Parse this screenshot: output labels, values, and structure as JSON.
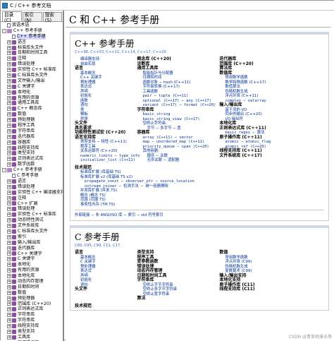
{
  "window": {
    "title": "C / C++ 参考文档"
  },
  "tabs": [
    {
      "label": "目录(C)"
    },
    {
      "label": "索引(N)"
    },
    {
      "label": "搜索(S)"
    }
  ],
  "tree": [
    {
      "t": "双语术语",
      "ic": "pg",
      "d": 0
    },
    {
      "t": "C++ 参考手册",
      "ic": "op",
      "d": 0,
      "ex": "-"
    },
    {
      "t": "C++ 参考手册",
      "ic": "pg",
      "d": 1,
      "sel": true
    },
    {
      "t": "语言",
      "ic": "bk",
      "d": 1,
      "ex": "+"
    },
    {
      "t": "标准库头文件",
      "ic": "bk",
      "d": 1,
      "ex": "+"
    },
    {
      "t": "日期和时间工具",
      "ic": "bk",
      "d": 1,
      "ex": "+"
    },
    {
      "t": "注释",
      "ic": "bk",
      "d": 1,
      "ex": "+"
    },
    {
      "t": "错误处理",
      "ic": "bk",
      "d": 1,
      "ex": "+"
    },
    {
      "t": "实验性 C++ 标准库",
      "ic": "bk",
      "d": 1,
      "ex": "+"
    },
    {
      "t": "C 标准库头文件",
      "ic": "bk",
      "d": 1,
      "ex": "+"
    },
    {
      "t": "文件输入/输出",
      "ic": "bk",
      "d": 1,
      "ex": "+"
    },
    {
      "t": "C 关键字",
      "ic": "bk",
      "d": 1,
      "ex": "+"
    },
    {
      "t": "本地化",
      "ic": "bk",
      "d": 1,
      "ex": "+"
    },
    {
      "t": "有用的资源",
      "ic": "bk",
      "d": 1,
      "ex": "+"
    },
    {
      "t": "通用工具库",
      "ic": "bk",
      "d": 1,
      "ex": "+"
    },
    {
      "t": "C++ 概念库",
      "ic": "bk",
      "d": 1,
      "ex": "+"
    },
    {
      "t": "数值",
      "ic": "bk",
      "d": 1,
      "ex": "+"
    },
    {
      "t": "预处理器",
      "ic": "bk",
      "d": 1,
      "ex": "+"
    },
    {
      "t": "程序工具",
      "ic": "bk",
      "d": 1,
      "ex": "+"
    },
    {
      "t": "字符串库",
      "ic": "bk",
      "d": 1,
      "ex": "+"
    },
    {
      "t": "迭代器库",
      "ic": "bk",
      "d": 1,
      "ex": "+"
    },
    {
      "t": "容器库",
      "ic": "bk",
      "d": 1,
      "ex": "+"
    },
    {
      "t": "线程支持库",
      "ic": "bk",
      "d": 1,
      "ex": "+"
    },
    {
      "t": "类型支持",
      "ic": "bk",
      "d": 1,
      "ex": "+"
    },
    {
      "t": "正则表达式库",
      "ic": "bk",
      "d": 1,
      "ex": "+"
    },
    {
      "t": "数学函数",
      "ic": "bk",
      "d": 1,
      "ex": "+"
    },
    {
      "t": "C++ 参考手册",
      "ic": "op",
      "d": 0,
      "ex": "-"
    },
    {
      "t": "C 参考手册",
      "ic": "pg",
      "d": 1
    },
    {
      "t": "语言",
      "ic": "bk",
      "d": 1,
      "ex": "+"
    },
    {
      "t": "错误处理",
      "ic": "bk",
      "d": 1,
      "ex": "+"
    },
    {
      "t": "实验性 C++ 编译器支持",
      "ic": "bk",
      "d": 1,
      "ex": "+"
    },
    {
      "t": "注释",
      "ic": "bk",
      "d": 1,
      "ex": "+"
    },
    {
      "t": "C++ 扩展",
      "ic": "bk",
      "d": 1,
      "ex": "+"
    },
    {
      "t": "错误处理",
      "ic": "bk",
      "d": 1,
      "ex": "+"
    },
    {
      "t": "实验性 C++ 标准库",
      "ic": "bk",
      "d": 1,
      "ex": "+"
    },
    {
      "t": "动态特性测试",
      "ic": "bk",
      "d": 1,
      "ex": "+"
    },
    {
      "t": "文件系统库",
      "ic": "bk",
      "d": 1,
      "ex": "+"
    },
    {
      "t": "C 标准库头文件",
      "ic": "bk",
      "d": 1,
      "ex": "+"
    },
    {
      "t": "索引",
      "ic": "bk",
      "d": 1,
      "ex": "+"
    },
    {
      "t": "输入/输出库",
      "ic": "bk",
      "d": 1,
      "ex": "+"
    },
    {
      "t": "迭代器库",
      "ic": "bk",
      "d": 1,
      "ex": "+"
    },
    {
      "t": "C++ 关键字",
      "ic": "bk",
      "d": 1,
      "ex": "+"
    },
    {
      "t": "C 关键字",
      "ic": "bk",
      "d": 1,
      "ex": "+"
    },
    {
      "t": "本地化",
      "ic": "bk",
      "d": 1,
      "ex": "+"
    },
    {
      "t": "有用的资源",
      "ic": "bk",
      "d": 1,
      "ex": "+"
    },
    {
      "t": "本地化库",
      "ic": "bk",
      "d": 1,
      "ex": "+"
    },
    {
      "t": "动态内存管理",
      "ic": "bk",
      "d": 1,
      "ex": "+"
    },
    {
      "t": "日期和时间",
      "ic": "bk",
      "d": 1,
      "ex": "+"
    },
    {
      "t": "数值",
      "ic": "bk",
      "d": 1,
      "ex": "+"
    },
    {
      "t": "预处理器",
      "ic": "bk",
      "d": 1,
      "ex": "+"
    },
    {
      "t": "范围库 (C++20)",
      "ic": "bk",
      "d": 1,
      "ex": "+"
    },
    {
      "t": "正则表达式库",
      "ic": "bk",
      "d": 1,
      "ex": "+"
    },
    {
      "t": "字符串库",
      "ic": "bk",
      "d": 1,
      "ex": "+"
    },
    {
      "t": "字符串库",
      "ic": "bk",
      "d": 1,
      "ex": "+"
    },
    {
      "t": "线程支持库",
      "ic": "bk",
      "d": 1,
      "ex": "+"
    },
    {
      "t": "类型支持",
      "ic": "bk",
      "d": 1,
      "ex": "+"
    },
    {
      "t": "工具库",
      "ic": "bk",
      "d": 1,
      "ex": "+"
    },
    {
      "t": "原子操作库",
      "ic": "bk",
      "d": 1,
      "ex": "+"
    }
  ],
  "main": {
    "title": "C 和 C++ 参考手册",
    "cpp": {
      "title": "C++ 参考手册",
      "versions": "C++98, C++03, C++11, C++14, C++17, C++20",
      "col1": [
        {
          "t": "编译器支持",
          "c": "i1"
        },
        {
          "t": "自由实现",
          "c": "i1"
        },
        {
          "t": "语言",
          "c": "b"
        },
        {
          "t": "基本概念",
          "c": "i1"
        },
        {
          "t": "C++ 关键字",
          "c": "i1"
        },
        {
          "t": "预处理器",
          "c": "i1"
        },
        {
          "t": "表达式",
          "c": "i1"
        },
        {
          "t": "声明",
          "c": "i1"
        },
        {
          "t": "初始化",
          "c": "i1"
        },
        {
          "t": "函数",
          "c": "i1"
        },
        {
          "t": "语句",
          "c": "i1"
        },
        {
          "t": "类",
          "c": "i1"
        },
        {
          "t": "模板",
          "c": "i1"
        },
        {
          "t": "异常",
          "c": "i1"
        },
        {
          "t": "头文件",
          "c": "b"
        },
        {
          "t": "具名要求",
          "c": "b"
        },
        {
          "t": "功能特性测试宏 (C++20)",
          "c": "b"
        },
        {
          "t": "语言支持库",
          "c": "b"
        },
        {
          "t": "类型支持 − 特性 (C++11)",
          "c": "i1"
        },
        {
          "t": "程序工具",
          "c": "i1"
        },
        {
          "t": "关系运算符 (C++20)",
          "c": "i1"
        },
        {
          "t": "numeric_limits − type_info",
          "c": "i1 m"
        },
        {
          "t": "initializer_list (C++11)",
          "c": "i1 m"
        }
      ],
      "col2": [
        {
          "t": "概念库 (C++20)",
          "c": "b"
        },
        {
          "t": "诊断库",
          "c": "b"
        },
        {
          "t": "通用工具库",
          "c": "b"
        },
        {
          "t": "智能指针与分配器",
          "c": "i1"
        },
        {
          "t": "日期和时间",
          "c": "i1"
        },
        {
          "t": "函数对象 − hash (C++11)",
          "c": "i1"
        },
        {
          "t": "字符串转换 (C++17)",
          "c": "i1"
        },
        {
          "t": "工具函数",
          "c": "i1"
        },
        {
          "t": "pair − tuple (C++11)",
          "c": "i1 m"
        },
        {
          "t": "optional (C++17) − any (C++17)",
          "c": "i1 m"
        },
        {
          "t": "variant (C++17) − format (C++20)",
          "c": "i1 m"
        },
        {
          "t": "字符串库",
          "c": "b"
        },
        {
          "t": "basic_string",
          "c": "i1 m"
        },
        {
          "t": "basic_string_view (C++17)",
          "c": "i1 m"
        },
        {
          "t": "空终止字符串:",
          "c": "i1"
        },
        {
          "t": "字节 − 多字节 − 宽",
          "c": "i2"
        },
        {
          "t": "容器库",
          "c": "b"
        },
        {
          "t": "array (C++11) − vector",
          "c": "i1 m"
        },
        {
          "t": "map − unordered_map (C++11)",
          "c": "i1 m"
        },
        {
          "t": "priority_queue − span (C++20)",
          "c": "i1 m"
        },
        {
          "t": "其他容器:",
          "c": "i1"
        },
        {
          "t": "顺序 − 关联",
          "c": "i2"
        },
        {
          "t": "无序关联 − 适配器",
          "c": "i2"
        }
      ],
      "col3": [
        {
          "t": "迭代器库",
          "c": "b"
        },
        {
          "t": "范围库 (C++20)",
          "c": "b"
        },
        {
          "t": "算法库",
          "c": "b"
        },
        {
          "t": "数值库",
          "c": "b"
        },
        {
          "t": "常用数学函数",
          "c": "i1"
        },
        {
          "t": "数学特殊函数 (C++17)",
          "c": "i1"
        },
        {
          "t": "数值算法",
          "c": "i1"
        },
        {
          "t": "伪随机数生成",
          "c": "i1"
        },
        {
          "t": "浮点环境 (C++11)",
          "c": "i1"
        },
        {
          "t": "complex − valarray",
          "c": "i1 m"
        },
        {
          "t": "输入/输出库",
          "c": "b"
        },
        {
          "t": "基于流的 I/O",
          "c": "i1"
        },
        {
          "t": "同步的输出 (C++20)",
          "c": "i1"
        },
        {
          "t": "I/O 操纵符",
          "c": "i1"
        },
        {
          "t": "本地化库",
          "c": "b"
        },
        {
          "t": "正则表达式库 (C++11)",
          "c": "b"
        },
        {
          "t": "basic_regex − 算法",
          "c": "i1 m"
        },
        {
          "t": "原子操作库 (C++11)",
          "c": "b"
        },
        {
          "t": "atomic − atomic_flag",
          "c": "i1 m"
        },
        {
          "t": "atomic_ref (C++20)",
          "c": "i1 m"
        },
        {
          "t": "线程支持库 (C++11)",
          "c": "b"
        },
        {
          "t": "文件系统库 (C++17)",
          "c": "b"
        }
      ],
      "tech": [
        {
          "t": "技术规范",
          "c": "b"
        },
        {
          "t": "标准库扩展 (库基础 TS)",
          "c": "i1"
        },
        {
          "t": "标准库扩展 v2 (库基础 TS v2)",
          "c": "i1"
        },
        {
          "t": "propagate_const − observer_ptr − source_location",
          "c": "i2 m"
        },
        {
          "t": "ostream_joiner − 检测手法 − 统一容器擦除",
          "c": "i2 m"
        },
        {
          "t": "并发库扩展 (并发 TS)",
          "c": "i1"
        },
        {
          "t": "概念 (概念 TS)",
          "c": "i1"
        },
        {
          "t": "范围 (范围 TS)",
          "c": "i1"
        },
        {
          "t": "事务性内存 (TM TS)",
          "c": "i1"
        }
      ],
      "footer": "外部链接 − 非 ANSI/ISO 库 − 索引 − std 符号索引"
    },
    "c": {
      "title": "C 参考手册",
      "versions": "C89, C95, C99, C11, C17",
      "col1": [
        {
          "t": "语言",
          "c": "b"
        },
        {
          "t": "基本概念",
          "c": "i1"
        },
        {
          "t": "C 关键字",
          "c": "i1"
        },
        {
          "t": "预处理器",
          "c": "i1"
        },
        {
          "t": "表达式",
          "c": "i1"
        },
        {
          "t": "声明",
          "c": "i1"
        },
        {
          "t": "初始化",
          "c": "i1"
        },
        {
          "t": "语句",
          "c": "i1"
        },
        {
          "t": "头文件",
          "c": "b"
        }
      ],
      "col2": [
        {
          "t": "类型支持",
          "c": "b"
        },
        {
          "t": "程序工具",
          "c": "b"
        },
        {
          "t": "变参数函数",
          "c": "b"
        },
        {
          "t": "错误处理",
          "c": "b"
        },
        {
          "t": "动态内存管理",
          "c": "b"
        },
        {
          "t": "日期和时间工具",
          "c": "b"
        },
        {
          "t": "字符串库",
          "c": "b"
        },
        {
          "t": "空终止字节字符串",
          "c": "i1"
        },
        {
          "t": "空终止多字节字符串",
          "c": "i1"
        },
        {
          "t": "空终止宽字符串",
          "c": "i1"
        },
        {
          "t": "算法",
          "c": "b"
        }
      ],
      "col3": [
        {
          "t": "数值",
          "c": "b"
        },
        {
          "t": "常用数学函数",
          "c": "i1"
        },
        {
          "t": "浮点环境 (C99)",
          "c": "i1"
        },
        {
          "t": "伪随机数生成",
          "c": "i1"
        },
        {
          "t": "复数算术 (C99)",
          "c": "i1"
        },
        {
          "t": "输入/输出支持",
          "c": "b"
        },
        {
          "t": "本地化支持",
          "c": "b"
        },
        {
          "t": "原子操作库 (C11)",
          "c": "b"
        },
        {
          "t": "线程支持库 (C11)",
          "c": "b"
        }
      ],
      "tech": "技术规范"
    }
  },
  "watermark": "CSDN @青草地溪水旁"
}
